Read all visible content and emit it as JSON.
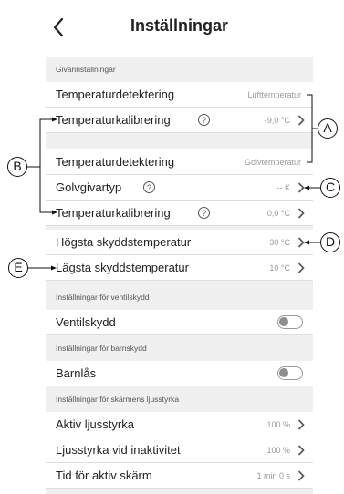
{
  "header": {
    "title": "Inställningar"
  },
  "sections": {
    "sensor": "Givarinställningar",
    "valve": "Inställningar för ventilskydd",
    "child": "Inställningar för barnskydd",
    "brightness": "Inställningar för skärmens ljusstyrka"
  },
  "rows": {
    "temp_detection_1": {
      "label": "Temperaturdetektering",
      "value": "Lufttemperatur"
    },
    "temp_calibration_1": {
      "label": "Temperaturkalibrering",
      "value": "-9,0 °C"
    },
    "temp_detection_2": {
      "label": "Temperaturdetektering",
      "value": "Golvtemperatur"
    },
    "floor_sensor_type": {
      "label": "Golvgivartyp",
      "value": "-- K"
    },
    "temp_calibration_2": {
      "label": "Temperaturkalibrering",
      "value": "0,0 °C"
    },
    "max_protect_temp": {
      "label": "Högsta skyddstemperatur",
      "value": "30 °C"
    },
    "min_protect_temp": {
      "label": "Lägsta skyddstemperatur",
      "value": "10 °C"
    },
    "valve_protection": {
      "label": "Ventilskydd",
      "on": false
    },
    "child_lock": {
      "label": "Barnlås",
      "on": false
    },
    "active_brightness": {
      "label": "Aktiv ljusstyrka",
      "value": "100 %"
    },
    "inactive_brightness": {
      "label": "Ljusstyrka vid inaktivitet",
      "value": "100 %"
    },
    "active_screen_time": {
      "label": "Tid för aktiv skärm",
      "value": "1 min 0 s"
    }
  },
  "help_glyph": "?",
  "callouts": {
    "a": "A",
    "b": "B",
    "c": "C",
    "d": "D",
    "e": "E"
  }
}
